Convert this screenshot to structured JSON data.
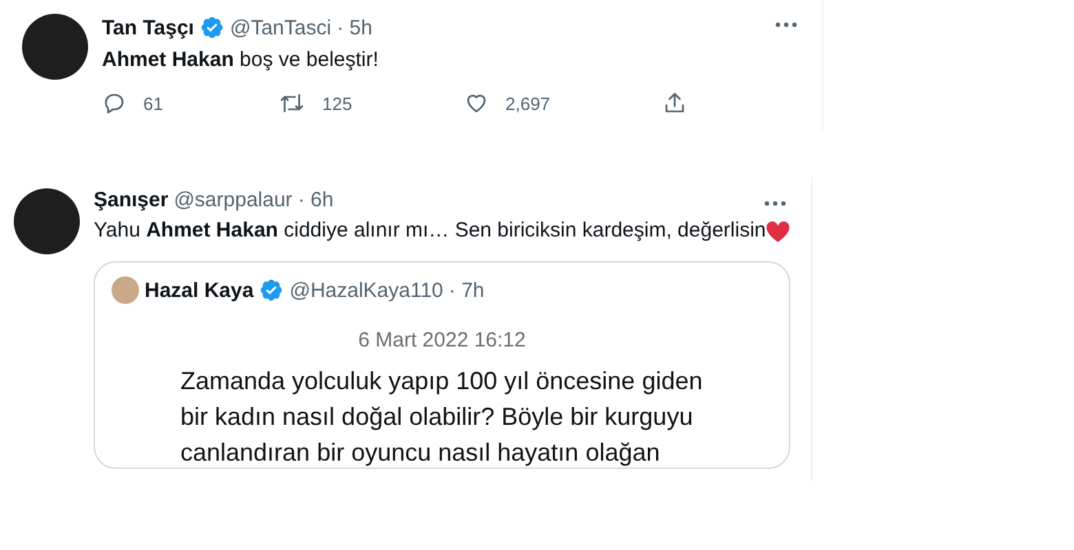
{
  "tweets": [
    {
      "author": "Tan Taşçı",
      "verified": true,
      "handle": "@TanTasci",
      "time": "· 5h",
      "text": "**Ahmet Hakan** boş ve beleştir!",
      "heart_emoji": false,
      "actions": [
        {
          "kind": "reply",
          "count": "61"
        },
        {
          "kind": "retweet",
          "count": "125"
        },
        {
          "kind": "like",
          "count": "2,697"
        },
        {
          "kind": "share"
        }
      ]
    },
    {
      "author": "Şanışer",
      "verified": false,
      "handle": "@sarppalaur",
      "time": "· 6h",
      "text": "Yahu **Ahmet Hakan** ciddiye alınır mı… Sen biriciksin kardeşim, değerlisin",
      "heart_emoji": true,
      "quote": {
        "author": "Hazal Kaya",
        "verified": true,
        "handle": "@HazalKaya110",
        "time": "· 7h",
        "image_date": "6 Mart 2022 16:12",
        "image_lines": [
          "Zamanda yolculuk yapıp 100 yıl öncesine giden",
          "bir kadın nasıl doğal olabilir? Böyle bir kurguyu",
          "canlandıran bir oyuncu nasıl hayatın olağan"
        ]
      }
    }
  ]
}
